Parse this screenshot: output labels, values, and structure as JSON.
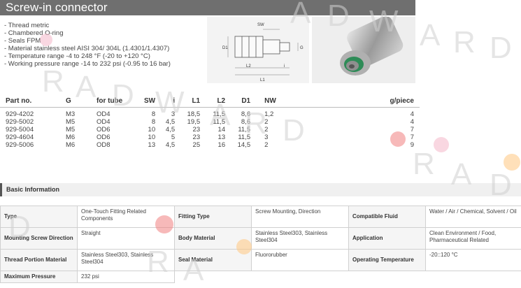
{
  "header": {
    "title": "Screw-in connector"
  },
  "features": [
    "- Thread metric",
    "- Chambered O-ring",
    "- Seals FPM",
    "- Material stainless steel AISI 304/ 304L (1.4301/1.4307)",
    "- Temperature range -4 to 248 °F (-20 to +120 °C)",
    "- Working pressure range -14 to 232 psi (-0.95 to 16 bar)"
  ],
  "diagram": {
    "sw": "SW",
    "d1": "D1",
    "g": "G",
    "l2": "L2",
    "i": "i",
    "l1": "L1"
  },
  "spec_table": {
    "headers": [
      "Part no.",
      "G",
      "for tube",
      "SW",
      "i",
      "L1",
      "L2",
      "D1",
      "NW",
      "g/piece"
    ],
    "rows": [
      [
        "929-4202",
        "M3",
        "OD4",
        "8",
        "3",
        "18,5",
        "11,5",
        "8,6",
        "1,2",
        "4"
      ],
      [
        "929-5002",
        "M5",
        "OD4",
        "8",
        "4,5",
        "19,5",
        "11,5",
        "8,6",
        "2",
        "4"
      ],
      [
        "929-5004",
        "M5",
        "OD6",
        "10",
        "4,5",
        "23",
        "14",
        "11,5",
        "2",
        "7"
      ],
      [
        "929-4604",
        "M6",
        "OD6",
        "10",
        "5",
        "23",
        "13",
        "11,5",
        "3",
        "7"
      ],
      [
        "929-5006",
        "M6",
        "OD8",
        "13",
        "4,5",
        "25",
        "16",
        "14,5",
        "2",
        "9"
      ]
    ]
  },
  "basic_info": {
    "title": "Basic Information",
    "rows": [
      [
        {
          "label": "Type",
          "value": "One-Touch Fitting Related Components"
        },
        {
          "label": "Fitting Type",
          "value": "Screw Mounting, Direction"
        },
        {
          "label": "Compatible Fluid",
          "value": "Water / Air / Chemical, Solvent / Oil"
        }
      ],
      [
        {
          "label": "Mounting Screw Direction",
          "value": "Straight"
        },
        {
          "label": "Body Material",
          "value": "Stainless Steel303, Stainless Steel304"
        },
        {
          "label": "Application",
          "value": "Clean Environment / Food, Pharmaceutical Related"
        }
      ],
      [
        {
          "label": "Thread Portion Material",
          "value": "Stainless Steel303, Stainless Steel304"
        },
        {
          "label": "Seal Material",
          "value": "Fluororubber"
        },
        {
          "label": "Operating Temperature",
          "value": "-20::120 °C"
        }
      ],
      [
        {
          "label": "Maximum Pressure",
          "value": "232 psi"
        }
      ]
    ]
  },
  "watermark": {
    "letter_r": "R",
    "letter_a": "A",
    "letter_d": "D",
    "letter_w": "W"
  },
  "colors": {
    "header_bg": "#6f6f6f",
    "ring_green": "#2e8b57",
    "dot_red": "#f08080",
    "dot_orange": "#ffc680",
    "dot_pink": "#f4b6c8"
  }
}
